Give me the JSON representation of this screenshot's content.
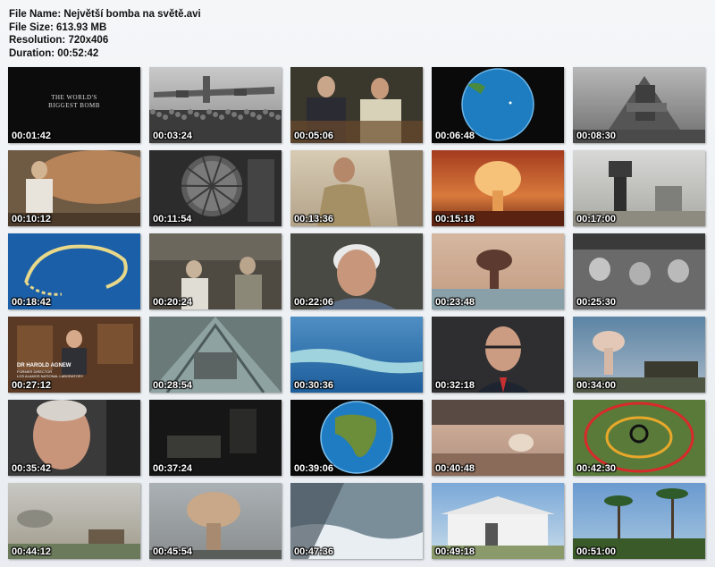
{
  "info": {
    "file_name": "File Name: Největší bomba na světě.avi",
    "file_size": "File Size: 613.93 MB",
    "resolution": "Resolution: 720x406",
    "duration": "Duration: 00:52:42"
  },
  "thumbnails": [
    {
      "time": "00:01:42",
      "scene": "title-card"
    },
    {
      "time": "00:03:24",
      "scene": "bomber-crowd"
    },
    {
      "time": "00:05:06",
      "scene": "leaders-seated"
    },
    {
      "time": "00:06:48",
      "scene": "globe-pacific"
    },
    {
      "time": "00:08:30",
      "scene": "warship"
    },
    {
      "time": "00:10:12",
      "scene": "bomb-workers"
    },
    {
      "time": "00:11:54",
      "scene": "bomb-device"
    },
    {
      "time": "00:13:36",
      "scene": "soldier-portrait"
    },
    {
      "time": "00:15:18",
      "scene": "fireball"
    },
    {
      "time": "00:17:00",
      "scene": "tower-site"
    },
    {
      "time": "00:18:42",
      "scene": "atoll-aerial"
    },
    {
      "time": "00:20:24",
      "scene": "control-room"
    },
    {
      "time": "00:22:06",
      "scene": "interview-man"
    },
    {
      "time": "00:23:48",
      "scene": "mushroom-lagoon"
    },
    {
      "time": "00:25:30",
      "scene": "scientists-ship"
    },
    {
      "time": "00:27:12",
      "scene": "office-interview"
    },
    {
      "time": "00:28:54",
      "scene": "tower-interior"
    },
    {
      "time": "00:30:36",
      "scene": "ocean-aerial"
    },
    {
      "time": "00:32:18",
      "scene": "glasses-interview"
    },
    {
      "time": "00:34:00",
      "scene": "mushroom-truck"
    },
    {
      "time": "00:35:42",
      "scene": "old-man-closeup"
    },
    {
      "time": "00:37:24",
      "scene": "dark-desk"
    },
    {
      "time": "00:39:06",
      "scene": "globe-africa"
    },
    {
      "time": "00:40:48",
      "scene": "horizon-blast"
    },
    {
      "time": "00:42:30",
      "scene": "target-circle"
    },
    {
      "time": "00:44:12",
      "scene": "smoke-village"
    },
    {
      "time": "00:45:54",
      "scene": "mushroom-cloud"
    },
    {
      "time": "00:47:36",
      "scene": "ship-waves"
    },
    {
      "time": "00:49:18",
      "scene": "white-building"
    },
    {
      "time": "00:51:00",
      "scene": "palm-trees"
    }
  ],
  "overlays": {
    "title_card": [
      "THE WORLD'S",
      "BIGGEST BOMB"
    ],
    "lower_third_name": "DR HAROLD AGNEW",
    "lower_third_role": [
      "FORMER DIRECTOR",
      "LOS ALAMOS NATIONAL LABORATORY"
    ]
  }
}
